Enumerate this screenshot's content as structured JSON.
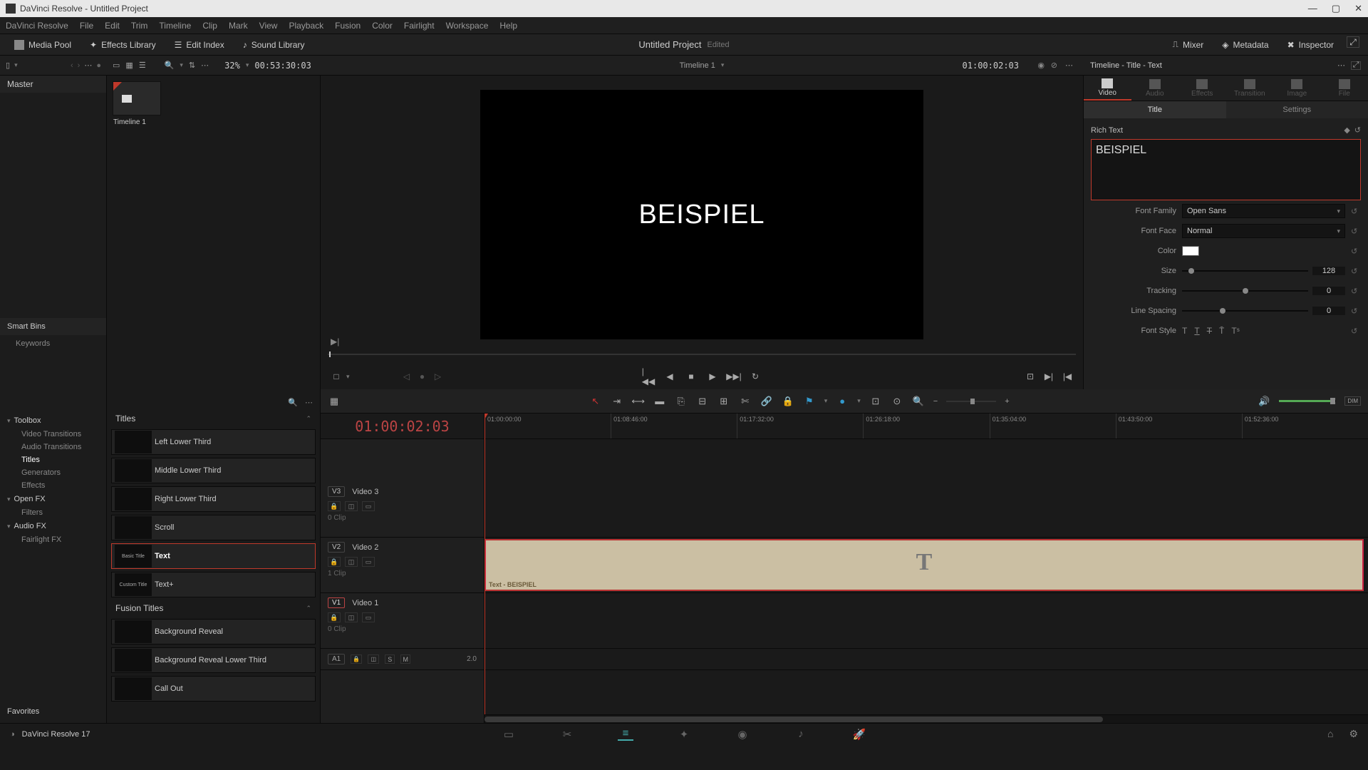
{
  "titlebar": {
    "app": "DaVinci Resolve - Untitled Project"
  },
  "menu": [
    "DaVinci Resolve",
    "File",
    "Edit",
    "Trim",
    "Timeline",
    "Clip",
    "Mark",
    "View",
    "Playback",
    "Fusion",
    "Color",
    "Fairlight",
    "Workspace",
    "Help"
  ],
  "toolbar": {
    "media_pool": "Media Pool",
    "effects_lib": "Effects Library",
    "edit_index": "Edit Index",
    "sound_lib": "Sound Library",
    "project": "Untitled Project",
    "edited": "Edited",
    "mixer": "Mixer",
    "metadata": "Metadata",
    "inspector": "Inspector"
  },
  "secondary": {
    "zoom": "32%",
    "src_tc": "00:53:30:03",
    "timeline_name": "Timeline 1",
    "rec_tc": "01:00:02:03",
    "inspector_title": "Timeline - Title - Text"
  },
  "media_pool": {
    "master": "Master",
    "clip_name": "Timeline 1"
  },
  "smartbins": {
    "header": "Smart Bins",
    "keywords": "Keywords"
  },
  "viewer": {
    "text": "BEISPIEL"
  },
  "inspector": {
    "tabs": [
      "Video",
      "Audio",
      "Effects",
      "Transition",
      "Image",
      "File"
    ],
    "subtabs": {
      "title": "Title",
      "settings": "Settings"
    },
    "section": "Rich Text",
    "text_value": "BEISPIEL",
    "props": {
      "font_family_l": "Font Family",
      "font_family_v": "Open Sans",
      "font_face_l": "Font Face",
      "font_face_v": "Normal",
      "color_l": "Color",
      "size_l": "Size",
      "size_v": "128",
      "tracking_l": "Tracking",
      "tracking_v": "0",
      "line_spacing_l": "Line Spacing",
      "line_spacing_v": "0",
      "font_style_l": "Font Style"
    }
  },
  "effects_browser": {
    "toolbox": "Toolbox",
    "video_trans": "Video Transitions",
    "audio_trans": "Audio Transitions",
    "titles": "Titles",
    "generators": "Generators",
    "effects": "Effects",
    "openfx": "Open FX",
    "filters": "Filters",
    "audiofx": "Audio FX",
    "fairlightfx": "Fairlight FX",
    "favorites": "Favorites"
  },
  "titles_list": {
    "header": "Titles",
    "fusion_header": "Fusion Titles",
    "items": [
      "Left Lower Third",
      "Middle Lower Third",
      "Right Lower Third",
      "Scroll",
      "Text",
      "Text+"
    ],
    "thumbs": [
      "",
      "",
      "",
      "",
      "Basic Title",
      "Custom Title"
    ],
    "fusion_items": [
      "Background Reveal",
      "Background Reveal Lower Third",
      "Call Out"
    ]
  },
  "timeline": {
    "tc": "01:00:02:03",
    "ruler": [
      "01:00:00:00",
      "01:08:46:00",
      "01:17:32:00",
      "01:26:18:00",
      "01:35:04:00",
      "01:43:50:00",
      "01:52:36:00"
    ],
    "tracks": {
      "v3": {
        "id": "V3",
        "name": "Video 3",
        "count": "0 Clip"
      },
      "v2": {
        "id": "V2",
        "name": "Video 2",
        "count": "1 Clip"
      },
      "v1": {
        "id": "V1",
        "name": "Video 1",
        "count": "0 Clip"
      },
      "a1": {
        "id": "A1",
        "count": "2.0"
      }
    },
    "clip_label": "Text - BEISPIEL"
  },
  "status": {
    "version": "DaVinci Resolve 17"
  }
}
